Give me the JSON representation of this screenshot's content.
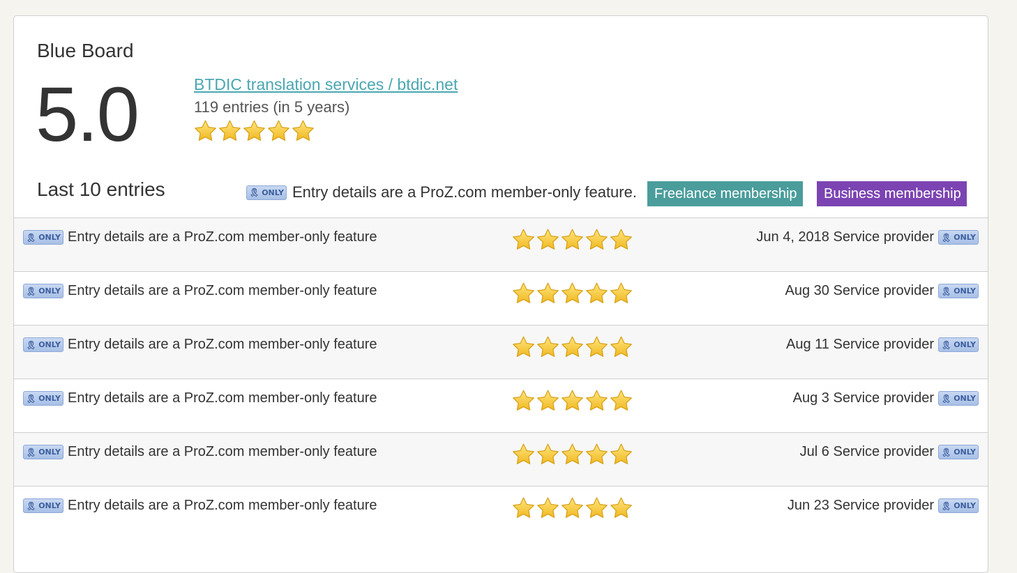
{
  "board": {
    "title": "Blue Board",
    "score": "5.0",
    "provider_link": "BTDIC translation services / btdic.net",
    "entries_summary": "119 entries (in 5 years)",
    "rating_stars": 5
  },
  "last_entries": {
    "heading": "Last 10 entries",
    "notice_text": "Entry details are a ProZ.com member-only feature.",
    "freelance_button": "Freelance membership",
    "business_button": "Business membership",
    "badge_label": "ONLY"
  },
  "colors": {
    "link": "#4aa7b1",
    "freelance": "#4a9d9b",
    "business": "#7b44b2",
    "star": "#f5c530"
  },
  "rows": [
    {
      "text": "Entry details are a ProZ.com member-only feature",
      "date": "Jun 4, 2018",
      "role": "Service provider",
      "stars": 5
    },
    {
      "text": "Entry details are a ProZ.com member-only feature",
      "date": "Aug 30",
      "role": "Service provider",
      "stars": 5
    },
    {
      "text": "Entry details are a ProZ.com member-only feature",
      "date": "Aug 11",
      "role": "Service provider",
      "stars": 5
    },
    {
      "text": "Entry details are a ProZ.com member-only feature",
      "date": "Aug 3",
      "role": "Service provider",
      "stars": 5
    },
    {
      "text": "Entry details are a ProZ.com member-only feature",
      "date": "Jul 6",
      "role": "Service provider",
      "stars": 5
    },
    {
      "text": "Entry details are a ProZ.com member-only feature",
      "date": "Jun 23",
      "role": "Service provider",
      "stars": 5
    }
  ]
}
